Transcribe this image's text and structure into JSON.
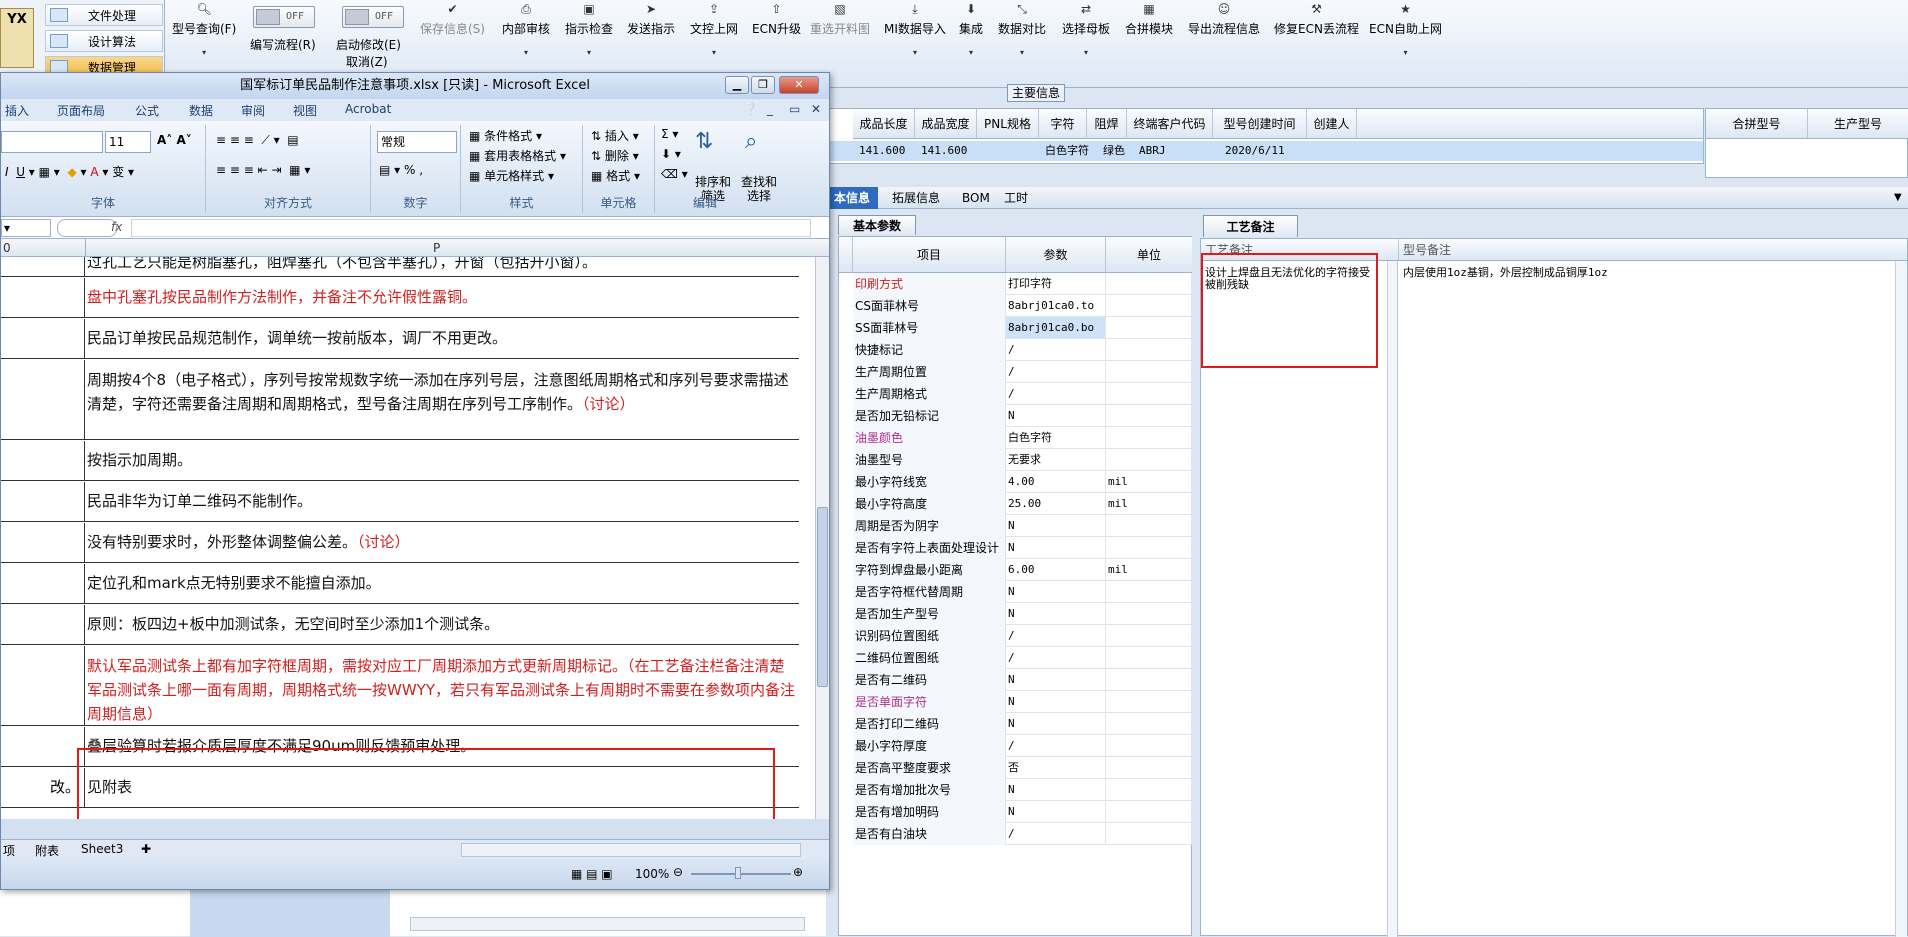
{
  "left_nav": {
    "logo_text": "YX",
    "items": [
      "文件处理",
      "设计算法",
      "数据管理"
    ]
  },
  "toolbar": {
    "model_query": "型号查询(F)",
    "write_flow": "编写流程(R)",
    "start_modify": "启动修改(E)",
    "cancel": "取消(Z)",
    "toggle_off": "OFF",
    "buttons": [
      "保存信息(S)",
      "内部审核",
      "指示检查",
      "发送指示",
      "文控上网",
      "ECN升级",
      "重选开料图",
      "MI数据导入",
      "集成",
      "数据对比",
      "选择母板",
      "合拼模块",
      "导出流程信息",
      "修复ECN丢流程",
      "ECN自助上网"
    ]
  },
  "main_info": {
    "tag": "主要信息",
    "columns": [
      "成品长度",
      "成品宽度",
      "PNL规格",
      "字符",
      "阻焊",
      "终端客户代码",
      "型号创建时间",
      "创建人"
    ],
    "row": [
      "141.600",
      "141.600",
      "",
      "白色字符",
      "绿色",
      "ABRJ",
      "2020/6/11",
      ""
    ],
    "right_columns": [
      "合拼型号",
      "生产型号"
    ]
  },
  "tabs": [
    "本信息",
    "拓展信息",
    "BOM",
    "工时"
  ],
  "basic_params": {
    "tab": "基本参数",
    "headers": [
      "项目",
      "参数",
      "单位"
    ],
    "rows": [
      {
        "item": "印刷方式",
        "value": "打印字符",
        "unit": "",
        "color": "red"
      },
      {
        "item": "CS面菲林号",
        "value": "8abrj01ca0.to",
        "unit": ""
      },
      {
        "item": "SS面菲林号",
        "value": "8abrj01ca0.bo",
        "unit": ""
      },
      {
        "item": "快捷标记",
        "value": "/",
        "unit": ""
      },
      {
        "item": "生产周期位置",
        "value": "/",
        "unit": ""
      },
      {
        "item": "生产周期格式",
        "value": "/",
        "unit": ""
      },
      {
        "item": "是否加无铅标记",
        "value": "N",
        "unit": ""
      },
      {
        "item": "油墨颜色",
        "value": "白色字符",
        "unit": "",
        "color": "purple"
      },
      {
        "item": "油墨型号",
        "value": "无要求",
        "unit": ""
      },
      {
        "item": "最小字符线宽",
        "value": "4.00",
        "unit": "mil"
      },
      {
        "item": "最小字符高度",
        "value": "25.00",
        "unit": "mil"
      },
      {
        "item": "周期是否为阴字",
        "value": "N",
        "unit": ""
      },
      {
        "item": "是否有字符上表面处理设计",
        "value": "N",
        "unit": ""
      },
      {
        "item": "字符到焊盘最小距离",
        "value": "6.00",
        "unit": "mil"
      },
      {
        "item": "是否字符框代替周期",
        "value": "N",
        "unit": ""
      },
      {
        "item": "是否加生产型号",
        "value": "N",
        "unit": ""
      },
      {
        "item": "识别码位置图纸",
        "value": "/",
        "unit": ""
      },
      {
        "item": "二维码位置图纸",
        "value": "/",
        "unit": ""
      },
      {
        "item": "是否有二维码",
        "value": "N",
        "unit": ""
      },
      {
        "item": "是否单面字符",
        "value": "N",
        "unit": "",
        "color": "purple"
      },
      {
        "item": "是否打印二维码",
        "value": "N",
        "unit": ""
      },
      {
        "item": "最小字符厚度",
        "value": "/",
        "unit": ""
      },
      {
        "item": "是否高平整度要求",
        "value": "否",
        "unit": ""
      },
      {
        "item": "是否有增加批次号",
        "value": "N",
        "unit": ""
      },
      {
        "item": "是否有增加明码",
        "value": "N",
        "unit": ""
      },
      {
        "item": "是否有白油块",
        "value": "/",
        "unit": ""
      }
    ]
  },
  "process_note": {
    "tab": "工艺备注",
    "col1": "工艺备注",
    "col2": "型号备注",
    "note1": "设计上焊盘且无法优化的字符接受被削残缺",
    "note2": "内层使用1oz基铜，外层控制成品铜厚1oz"
  },
  "excel": {
    "title": "国军标订单民品制作注意事项.xlsx [只读] - Microsoft Excel",
    "menu": [
      "插入",
      "页面布局",
      "公式",
      "数据",
      "审阅",
      "视图",
      "Acrobat"
    ],
    "font_size": "11",
    "number_format": "常规",
    "groups": [
      "字体",
      "对齐方式",
      "数字",
      "样式",
      "单元格",
      "编辑"
    ],
    "styles": [
      "条件格式",
      "套用表格格式",
      "单元格样式"
    ],
    "cells_cmds": [
      "插入",
      "删除",
      "格式"
    ],
    "edit_cmds": [
      "排序和筛选",
      "查找和选择"
    ],
    "namebox": "0",
    "fx": "fx",
    "col_header": "P",
    "rows": [
      {
        "text": "过孔工艺只能是树脂塞孔，阻焊塞孔（不包含半塞孔），开窗（包括开小窗）。",
        "discuss": ""
      },
      {
        "text": "盘中孔塞孔按民品制作方法制作，并备注不允许假性露铜。",
        "discuss": "",
        "red": true
      },
      {
        "text": "民品订单按民品规范制作，调单统一按前版本，调厂不用更改。",
        "discuss": ""
      },
      {
        "text": "周期按4个8（电子格式），序列号按常规数字统一添加在序列号层，注意图纸周期格式和序列号要求需描述清楚，字符还需要备注周期和周期格式，型号备注周期在序列号工序制作。",
        "discuss": "（讨论）"
      },
      {
        "text": "按指示加周期。",
        "discuss": ""
      },
      {
        "text": "民品非华为订单二维码不能制作。",
        "discuss": ""
      },
      {
        "text": "没有特别要求时，外形整体调整偏公差。",
        "discuss": "（讨论）"
      },
      {
        "text": "定位孔和mark点无特别要求不能擅自添加。",
        "discuss": ""
      },
      {
        "text": "原则：板四边+板中加测试条，无空间时至少添加1个测试条。",
        "discuss": ""
      },
      {
        "text": "默认军品测试条上都有加字符框周期，需按对应工厂周期添加方式更新周期标记。（在工艺备注栏备注清楚军品测试条上哪一面有周期，周期格式统一按WWYY，若只有军品测试条上有周期时不需要在参数项内备注周期信息）",
        "discuss": "",
        "red": true
      },
      {
        "text": "叠层验算时若报介质层厚度不满足90um则反馈预审处理。",
        "discuss": ""
      },
      {
        "text": "见附表",
        "discuss": "",
        "left": "改。"
      }
    ],
    "sheet_tabs": [
      "项",
      "附表",
      "Sheet3"
    ],
    "zoom": "100%"
  }
}
